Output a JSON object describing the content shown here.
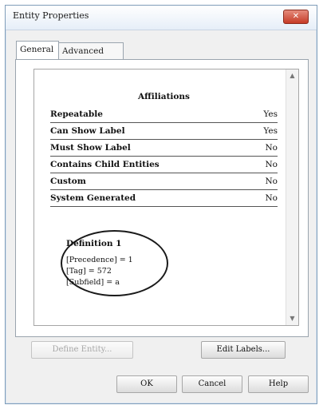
{
  "window": {
    "title": "Entity Properties",
    "close_symbol": "✕"
  },
  "tabs": [
    {
      "label": "General",
      "active": true
    },
    {
      "label": "Advanced",
      "active": false
    }
  ],
  "panel": {
    "section_title": "Affiliations",
    "properties": [
      {
        "name": "Repeatable",
        "value": "Yes"
      },
      {
        "name": "Can Show Label",
        "value": "Yes"
      },
      {
        "name": "Must Show Label",
        "value": "No"
      },
      {
        "name": "Contains Child Entities",
        "value": "No"
      },
      {
        "name": "Custom",
        "value": "No"
      },
      {
        "name": "System Generated",
        "value": "No"
      }
    ],
    "definition": {
      "title": "Definition 1",
      "lines": [
        "[Precedence] = 1",
        "[Tag] = 572",
        "[Subfield] = a"
      ]
    },
    "scroll_up": "▲",
    "scroll_down": "▼"
  },
  "buttons": {
    "define_entity": "Define Entity...",
    "edit_labels": "Edit Labels...",
    "ok": "OK",
    "cancel": "Cancel",
    "help": "Help"
  },
  "colors": {
    "close_button": "#c63b27",
    "highlight_ellipse": "#1a1a1a"
  }
}
